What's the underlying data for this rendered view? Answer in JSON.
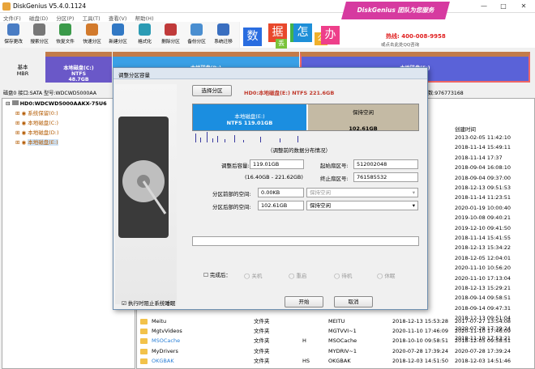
{
  "app": {
    "title": "DiskGenius V5.4.0.1124"
  },
  "menu": [
    "文件(F)",
    "磁盘(D)",
    "分区(P)",
    "工具(T)",
    "查看(V)",
    "帮助(H)"
  ],
  "toolbar": [
    "保存更改",
    "搜索分区",
    "恢复文件",
    "快速分区",
    "新建分区",
    "格式化",
    "删除分区",
    "备份分区",
    "系统迁移"
  ],
  "banner": {
    "chars": [
      "数",
      "据",
      "丢",
      "失",
      "怎",
      "么",
      "办"
    ],
    "slogan": "DiskGenius 团队为您服务",
    "phone": "热线: 400-008-9958",
    "qq": "或点击此处QQ咨询"
  },
  "diskmap": {
    "left1": "基本",
    "left2": "MBR",
    "partitions": [
      {
        "name": "本地磁盘(C:)",
        "fs": "NTFS",
        "size": "48.7GB"
      },
      {
        "name": "本地磁盘(D:)",
        "fs": "",
        "size": ""
      },
      {
        "name": "本地磁盘(E:)",
        "fs": "",
        "size": ""
      }
    ]
  },
  "infoline": {
    "left": "磁盘0 接口:SATA  型号:WDCWD5000AA",
    "right": "数:976773168"
  },
  "tree": {
    "root": "HD0:WDCWD5000AAKX-75U6",
    "items": [
      "系统保留(0:)",
      "本地磁盘(C:)",
      "本地磁盘(D:)",
      "本地磁盘(E:)"
    ]
  },
  "files_header": {
    "modified": "创建时间"
  },
  "files_dates": [
    "2013-02-05 11:42:10",
    "2018-11-14 15:49:11",
    "2018-11-14 17:37",
    "2018-09-04 16:08:10",
    "2018-09-04 09:37:00",
    "2018-12-13 09:51:53",
    "2018-11-14 11:23:51",
    "2020-01-19 10:00:40",
    "2019-10-08 09:40:21",
    "2019-12-10 09:41:50",
    "2018-11-14 15:41:55",
    "2018-12-13 15:34:22",
    "2018-12-05 12:04:01",
    "2020-11-10 10:56:20",
    "2020-11-10 17:13:04",
    "2018-12-13 15:29:21",
    "2018-09-14 09:58:51",
    "2018-09-14 09:47:31",
    "2018-12-13 09:51:04",
    "2020-07-28 17:39:24",
    "2018-11-10 17:53:21"
  ],
  "files_rows": [
    {
      "name": "Meitu",
      "type": "文件夹",
      "attr": "",
      "short": "MEITU",
      "modified": "2018-12-13 15:53:28",
      "created": "2017-07-27 13:54:08"
    },
    {
      "name": "MgtvVideos",
      "type": "文件夹",
      "attr": "",
      "short": "MGTVVI~1",
      "modified": "2020-11-10 17:46:09",
      "created": "2020-11-10 17:46:09"
    },
    {
      "name": "MSOCache",
      "type": "文件夹",
      "attr": "H",
      "short": "MSOCache",
      "modified": "2018-10-10 09:58:51",
      "created": "2018-12-05 09:58:51"
    },
    {
      "name": "MyDrivers",
      "type": "文件夹",
      "attr": "",
      "short": "MYDRIV~1",
      "modified": "2020-07-28 17:39:24",
      "created": "2020-07-28 17:39:24"
    },
    {
      "name": "OKGBAK",
      "type": "文件夹",
      "attr": "HS",
      "short": "OKGBAK",
      "modified": "2018-12-03 14:51:50",
      "created": "2018-12-03 14:51:46"
    }
  ],
  "dialog": {
    "title": "调整分区容量",
    "select_btn": "选择分区",
    "partition_label": "HD0:本地磁盘(E:) NTFS 221.6GB",
    "bar_left_name": "本地磁盘(E:)",
    "bar_left_sub": "NTFS 119.01GB",
    "bar_right_name": "保持空闲",
    "bar_right_size": "102.61GB",
    "hint": "（调整前的数据分布情况）",
    "size_label": "调整后容量:",
    "size_value": "119.01GB",
    "range": "(16.40GB - 221.62GB)",
    "start_label": "起始扇区号:",
    "start_value": "512002048",
    "end_label": "终止扇区号:",
    "end_value": "761585532",
    "before_label": "分区前部的空间:",
    "before_value": "0.00KB",
    "before_action": "保持空闲",
    "after_label": "分区后部的空间:",
    "after_value": "102.61GB",
    "after_action": "保持空闲",
    "complete_label": "完成后：",
    "opts": [
      "关机",
      "重启",
      "待机",
      "休眠"
    ],
    "bg_check": "执行时阻止系统睡眠",
    "start_btn": "开始",
    "cancel_btn": "取消"
  },
  "colors": {
    "partC": "#6a58c8",
    "partD": "#3aa0e6",
    "partE": "#5a62d8",
    "free": "#c4baa4"
  }
}
